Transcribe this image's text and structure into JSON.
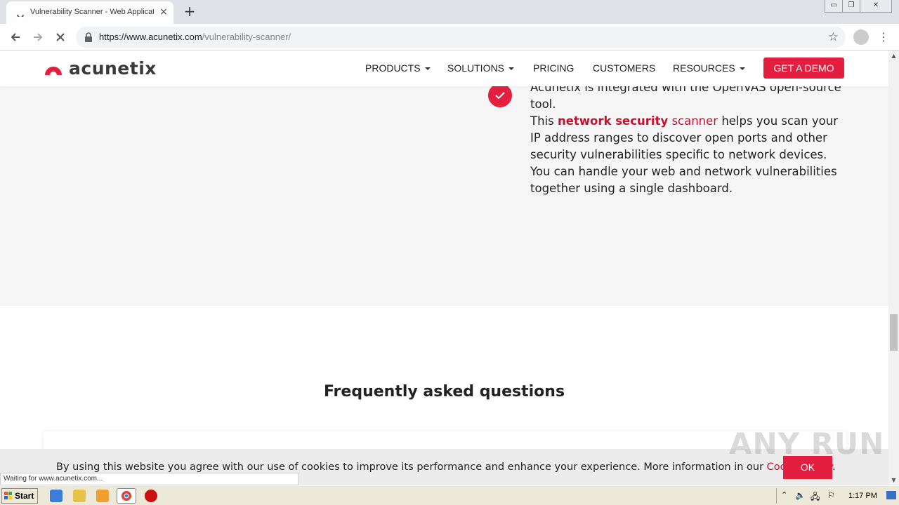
{
  "browser": {
    "tab_title": "Vulnerability Scanner - Web Applicati",
    "tab_close": "×",
    "new_tab": "+",
    "url_host": "https://www.acunetix.com",
    "url_path": "/vulnerability-scanner/",
    "window_buttons": {
      "minimize": "▭",
      "restore": "❐",
      "close": "✕"
    }
  },
  "site": {
    "logo_text": "acunetix",
    "nav": {
      "products": "PRODUCTS",
      "solutions": "SOLUTIONS",
      "pricing": "PRICING",
      "customers": "CUSTOMERS",
      "resources": "RESOURCES",
      "cta": "GET A DEMO"
    },
    "feature": {
      "line_intro": "Acunetix is integrated with the OpenVAS open-source tool.",
      "this": "This ",
      "link_bold": "network security",
      "link_rest": " scanner",
      "body": " helps you scan your IP address ranges to discover open ports and other security vulnerabilities specific to network devices. You can handle your web and network vulnerabilities together using a single dashboard."
    },
    "faq_title": "Frequently asked questions"
  },
  "cookie": {
    "text": "By using this website you agree with our use of cookies to improve its performance and enhance your experience. More information in our ",
    "link": "Cookie Policy",
    "end": ".",
    "ok": "OK"
  },
  "watermark": "ANY RUN",
  "status_text": "Waiting for www.acunetix.com...",
  "taskbar": {
    "start": "Start",
    "clock": "1:17 PM"
  },
  "colors": {
    "accent": "#e31e3e",
    "link": "#c8102e"
  }
}
